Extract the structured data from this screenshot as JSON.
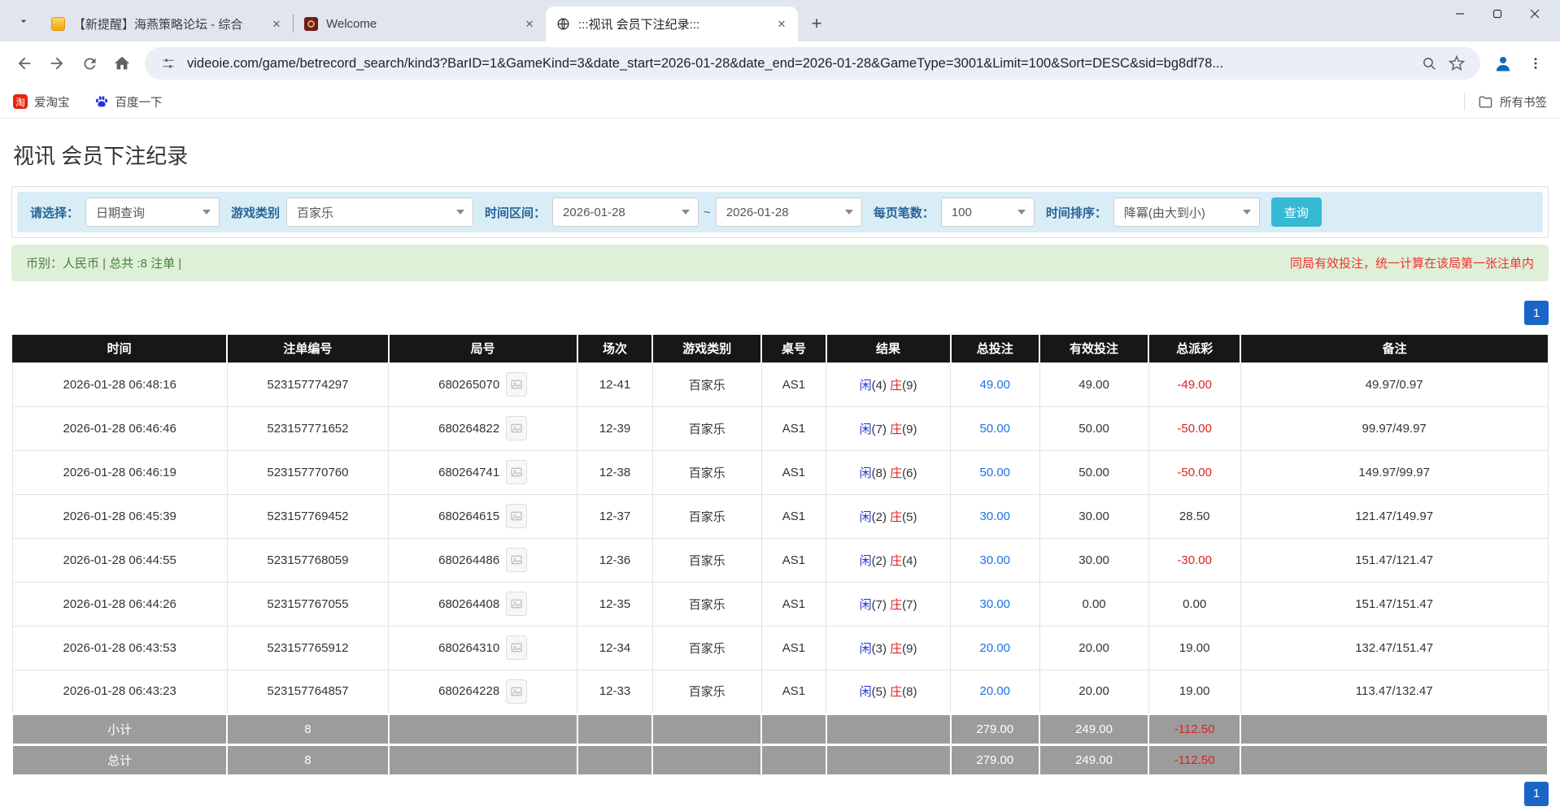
{
  "browser": {
    "tabs": [
      {
        "title": "【新提醒】海燕策略论坛 - 综合",
        "icon": "forum-icon"
      },
      {
        "title": "Welcome",
        "icon": "welcome-icon"
      },
      {
        "title": ":::视讯 会员下注纪录:::",
        "icon": "globe-icon"
      }
    ],
    "url": "videoie.com/game/betrecord_search/kind3?BarID=1&GameKind=3&date_start=2026-01-28&date_end=2026-01-28&GameType=3001&Limit=100&Sort=DESC&sid=bg8df78...",
    "bookmarks": {
      "taobao": "爱淘宝",
      "baidu": "百度一下",
      "all_bookmarks": "所有书签"
    }
  },
  "page": {
    "title": "视讯 会员下注纪录",
    "filters": {
      "select_label": "请选择：",
      "select_value": "日期查询",
      "game_label": "游戏类别",
      "game_value": "百家乐",
      "range_label": "时间区间：",
      "date_start": "2026-01-28",
      "tilde": "~",
      "date_end": "2026-01-28",
      "per_page_label": "每页笔数：",
      "per_page_value": "100",
      "sort_label": "时间排序：",
      "sort_value": "降冪(由大到小)",
      "search_button": "查询"
    },
    "info_bar": {
      "left": "币别：人民币 | 总共 :8 注单 |",
      "right": "同局有效投注，统一计算在该局第一张注单内"
    },
    "pagination": "1",
    "colors": {
      "accent_cyan": "#36b9d3",
      "pagination_blue": "#1a66c8",
      "negative_red": "#e02020",
      "player_blue": "#2433dd",
      "link_blue": "#1a73e8"
    },
    "table": {
      "headers": [
        "时间",
        "注单编号",
        "局号",
        "场次",
        "游戏类别",
        "桌号",
        "结果",
        "总投注",
        "有效投注",
        "总派彩",
        "备注"
      ],
      "rows": [
        {
          "time": "2026-01-28 06:48:16",
          "bet_id": "523157774297",
          "round_id": "680265070",
          "session": "12-41",
          "game": "百家乐",
          "table_no": "AS1",
          "player": "闲",
          "player_score": "(4)",
          "banker": "庄",
          "banker_score": "(9)",
          "total_bet": "49.00",
          "valid_bet": "49.00",
          "payout": "-49.00",
          "remark": "49.97/0.97"
        },
        {
          "time": "2026-01-28 06:46:46",
          "bet_id": "523157771652",
          "round_id": "680264822",
          "session": "12-39",
          "game": "百家乐",
          "table_no": "AS1",
          "player": "闲",
          "player_score": "(7)",
          "banker": "庄",
          "banker_score": "(9)",
          "total_bet": "50.00",
          "valid_bet": "50.00",
          "payout": "-50.00",
          "remark": "99.97/49.97"
        },
        {
          "time": "2026-01-28 06:46:19",
          "bet_id": "523157770760",
          "round_id": "680264741",
          "session": "12-38",
          "game": "百家乐",
          "table_no": "AS1",
          "player": "闲",
          "player_score": "(8)",
          "banker": "庄",
          "banker_score": "(6)",
          "total_bet": "50.00",
          "valid_bet": "50.00",
          "payout": "-50.00",
          "remark": "149.97/99.97"
        },
        {
          "time": "2026-01-28 06:45:39",
          "bet_id": "523157769452",
          "round_id": "680264615",
          "session": "12-37",
          "game": "百家乐",
          "table_no": "AS1",
          "player": "闲",
          "player_score": "(2)",
          "banker": "庄",
          "banker_score": "(5)",
          "total_bet": "30.00",
          "valid_bet": "30.00",
          "payout": "28.50",
          "remark": "121.47/149.97"
        },
        {
          "time": "2026-01-28 06:44:55",
          "bet_id": "523157768059",
          "round_id": "680264486",
          "session": "12-36",
          "game": "百家乐",
          "table_no": "AS1",
          "player": "闲",
          "player_score": "(2)",
          "banker": "庄",
          "banker_score": "(4)",
          "total_bet": "30.00",
          "valid_bet": "30.00",
          "payout": "-30.00",
          "remark": "151.47/121.47"
        },
        {
          "time": "2026-01-28 06:44:26",
          "bet_id": "523157767055",
          "round_id": "680264408",
          "session": "12-35",
          "game": "百家乐",
          "table_no": "AS1",
          "player": "闲",
          "player_score": "(7)",
          "banker": "庄",
          "banker_score": "(7)",
          "total_bet": "30.00",
          "valid_bet": "0.00",
          "payout": "0.00",
          "remark": "151.47/151.47"
        },
        {
          "time": "2026-01-28 06:43:53",
          "bet_id": "523157765912",
          "round_id": "680264310",
          "session": "12-34",
          "game": "百家乐",
          "table_no": "AS1",
          "player": "闲",
          "player_score": "(3)",
          "banker": "庄",
          "banker_score": "(9)",
          "total_bet": "20.00",
          "valid_bet": "20.00",
          "payout": "19.00",
          "remark": "132.47/151.47"
        },
        {
          "time": "2026-01-28 06:43:23",
          "bet_id": "523157764857",
          "round_id": "680264228",
          "session": "12-33",
          "game": "百家乐",
          "table_no": "AS1",
          "player": "闲",
          "player_score": "(5)",
          "banker": "庄",
          "banker_score": "(8)",
          "total_bet": "20.00",
          "valid_bet": "20.00",
          "payout": "19.00",
          "remark": "113.47/132.47"
        }
      ],
      "subtotal": {
        "label": "小计",
        "count": "8",
        "total_bet": "279.00",
        "valid_bet": "249.00",
        "payout": "-112.50"
      },
      "total": {
        "label": "总计",
        "count": "8",
        "total_bet": "279.00",
        "valid_bet": "249.00",
        "payout": "-112.50"
      }
    }
  }
}
